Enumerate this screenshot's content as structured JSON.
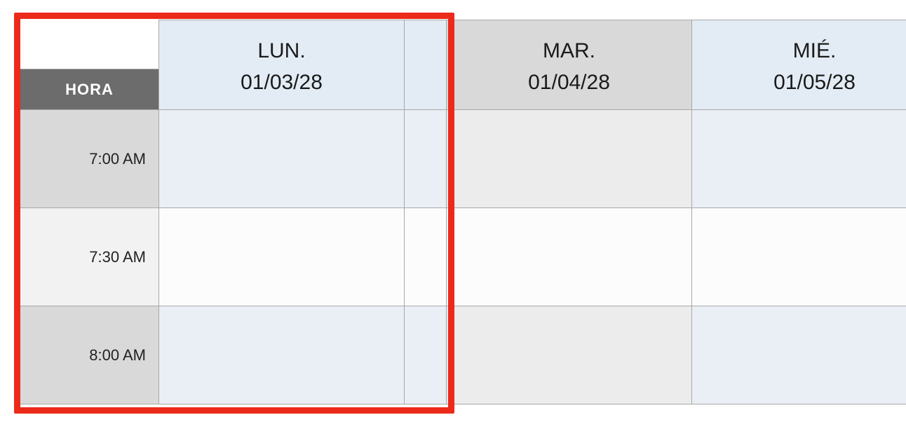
{
  "header": {
    "hora_label": "HORA",
    "days": [
      {
        "abbr": "LUN.",
        "date": "01/03/28"
      },
      {
        "abbr": "MAR.",
        "date": "01/04/28"
      },
      {
        "abbr": "MIÉ.",
        "date": "01/05/28"
      }
    ]
  },
  "times": [
    "7:00 AM",
    "7:30 AM",
    "8:00 AM"
  ]
}
